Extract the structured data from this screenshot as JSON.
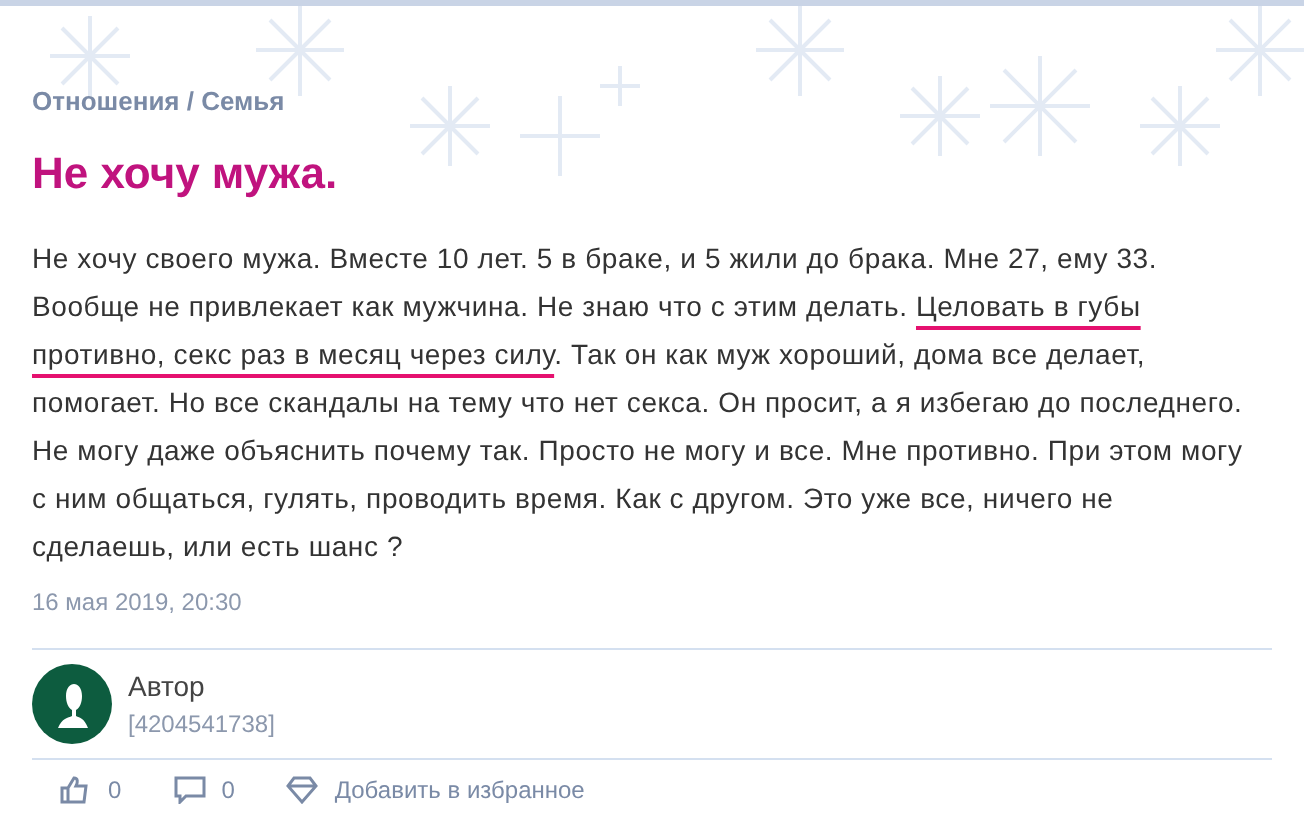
{
  "breadcrumb": "Отношения / Семья",
  "title": "Не хочу мужа.",
  "body": [
    {
      "text": "Не хочу своего мужа. Вместе 10 лет. 5 в браке, и 5 жили до брака. Мне 27, ему 33. Вообще не привлекает как мужчина. Не знаю что с этим делать. ",
      "underlined": false
    },
    {
      "text": "Целовать в губы противно, секс раз в месяц через силу",
      "underlined": true
    },
    {
      "text": ". Так он как муж хороший, дома все делает, помогает. Но все скандалы на тему что нет секса. Он просит, а я избегаю до последнего. Не могу даже объяснить почему так. Просто не могу и все. Мне противно. При этом могу с ним общаться, гулять, проводить время. Как с другом. Это уже все, ничего не сделаешь, или есть шанс ?",
      "underlined": false
    }
  ],
  "date": "16 мая 2019, 20:30",
  "author": {
    "name": "Автор",
    "id": "[4204541738]"
  },
  "actions": [
    {
      "kind": "like",
      "label": "0"
    },
    {
      "kind": "comment",
      "label": "0"
    },
    {
      "kind": "favorite",
      "label": "Добавить в избранное"
    }
  ]
}
